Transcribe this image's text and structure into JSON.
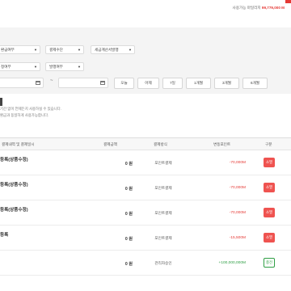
{
  "header": {
    "available_label": "사용가능 마일리지",
    "available_value": "99,779,000 M",
    "accent": "#e53935"
  },
  "filters": {
    "row1": [
      "환급여부",
      "결제수단",
      "세금계산서발행"
    ],
    "row2": [
      "정여부",
      "발행여부"
    ],
    "date_separator": "~",
    "periods": [
      "오늘",
      "어제",
      "7일",
      "1개월",
      "3개월",
      "6개월"
    ]
  },
  "notice": {
    "line1": "기간 없이 언제든지 사용하실 수 있습니다.",
    "line2": "환급과 동일하게 사용가능합니다."
  },
  "table": {
    "headers": {
      "detail": "결제내역 및 결제일시",
      "amount": "결제금액",
      "method": "결제방식",
      "points": "변동포인트",
      "type": "구분"
    },
    "rows": [
      {
        "name": "등록(상품수정)",
        "amount": "0 원",
        "method": "포인트결제",
        "points": "-70,000M",
        "type": "소멸",
        "kind": "use"
      },
      {
        "name": "등록(상품수정)",
        "amount": "0 원",
        "method": "포인트결제",
        "points": "-70,000M",
        "type": "소멸",
        "kind": "use"
      },
      {
        "name": "등록(상품수정)",
        "amount": "0 원",
        "method": "포인트결제",
        "points": "-70,000M",
        "type": "소멸",
        "kind": "use"
      },
      {
        "name": "등록",
        "amount": "0 원",
        "method": "포인트결제",
        "points": "-15,500M",
        "type": "소멸",
        "kind": "use"
      },
      {
        "name": "",
        "amount": "0 원",
        "method": "관리자승인",
        "points": "+100,000,000M",
        "type": "충전",
        "kind": "charge"
      }
    ],
    "colors": {
      "negative": "#e53935",
      "positive": "#2e9e44",
      "badge_use": "#ef5350"
    }
  }
}
